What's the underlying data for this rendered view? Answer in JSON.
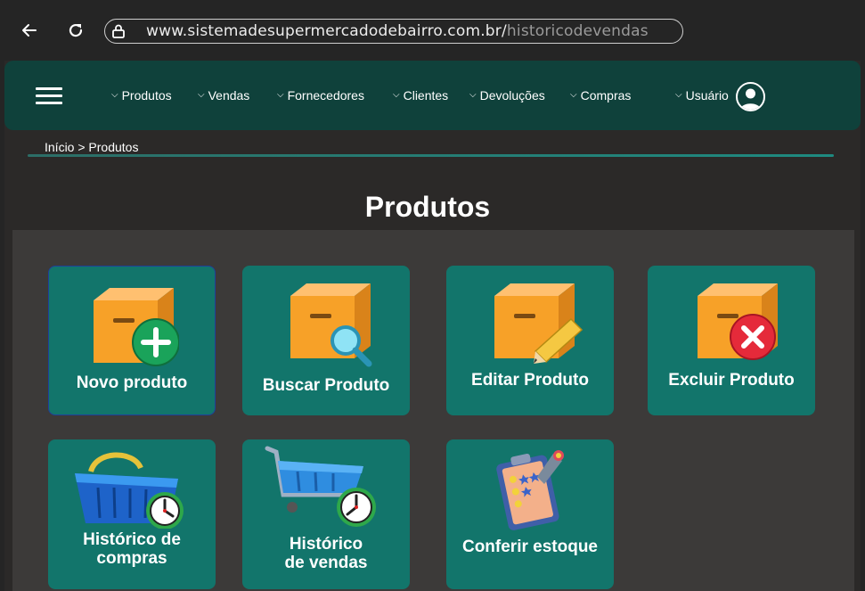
{
  "browser": {
    "url_domain": "www.sistemadesupermercadodebairro.com.br/",
    "url_path": "historicodevendas"
  },
  "nav": {
    "items": [
      "Produtos",
      "Vendas",
      "Fornecedores",
      "Clientes",
      "Devoluções",
      "Compras"
    ],
    "user_label": "Usuário"
  },
  "breadcrumb": "Início > Produtos",
  "page_title": "Produtos",
  "cards": [
    {
      "label": "Novo produto",
      "icon": "box-plus-icon"
    },
    {
      "label": "Buscar Produto",
      "icon": "box-search-icon"
    },
    {
      "label": "Editar Produto",
      "icon": "box-edit-icon"
    },
    {
      "label": "Excluir Produto",
      "icon": "box-delete-icon"
    },
    {
      "label_line1": "Histórico de",
      "label_line2": "compras",
      "icon": "basket-clock-icon"
    },
    {
      "label_line1": "Histórico",
      "label_line2": "de vendas",
      "icon": "cart-clock-icon"
    },
    {
      "label": "Conferir estoque",
      "icon": "clipboard-checklist-icon"
    }
  ],
  "colors": {
    "nav_bg": "#0f413b",
    "card_bg": "#12756b",
    "panel_bg": "#3c3a39",
    "page_bg": "#2b2928"
  }
}
